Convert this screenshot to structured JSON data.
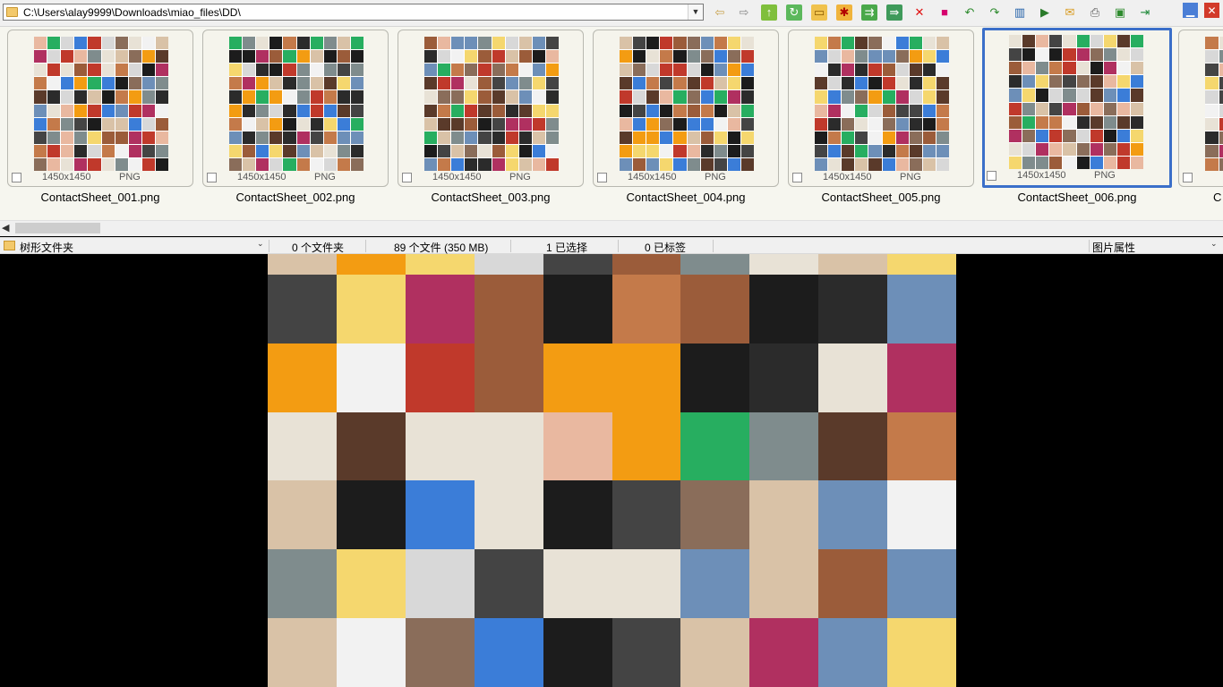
{
  "address_bar": {
    "path": "C:\\Users\\alay9999\\Downloads\\miao_files\\DD\\"
  },
  "toolbar_icons": [
    "back-arrow-icon",
    "forward-arrow-icon",
    "up-folder-icon",
    "refresh-folder-icon",
    "open-folder-icon",
    "new-folder-icon",
    "copy-to-icon",
    "move-to-icon",
    "delete-icon",
    "select-icon",
    "rotate-left-icon",
    "rotate-right-icon",
    "compare-icon",
    "slideshow-icon",
    "email-icon",
    "print-icon",
    "convert-icon",
    "exit-icon"
  ],
  "thumbnails": [
    {
      "filename": "ContactSheet_001.png",
      "dimensions": "1450x1450",
      "format": "PNG",
      "selected": false
    },
    {
      "filename": "ContactSheet_002.png",
      "dimensions": "1450x1450",
      "format": "PNG",
      "selected": false
    },
    {
      "filename": "ContactSheet_003.png",
      "dimensions": "1450x1450",
      "format": "PNG",
      "selected": false
    },
    {
      "filename": "ContactSheet_004.png",
      "dimensions": "1450x1450",
      "format": "PNG",
      "selected": false
    },
    {
      "filename": "ContactSheet_005.png",
      "dimensions": "1450x1450",
      "format": "PNG",
      "selected": false
    },
    {
      "filename": "ContactSheet_006.png",
      "dimensions": "1450x1450",
      "format": "PNG",
      "selected": true
    },
    {
      "filename": "C",
      "dimensions": "",
      "format": "",
      "selected": false
    }
  ],
  "status_bar": {
    "tree_label": "树形文件夹",
    "folders": "0 个文件夹",
    "files": "89 个文件 (350 MB)",
    "selected": "1 已选择",
    "tagged": "0  已标签",
    "properties": "图片属性"
  },
  "colors": {
    "accent_selection": "#3b6fc9",
    "strip_background": "#f6f6ef",
    "preview_background": "#000000"
  }
}
